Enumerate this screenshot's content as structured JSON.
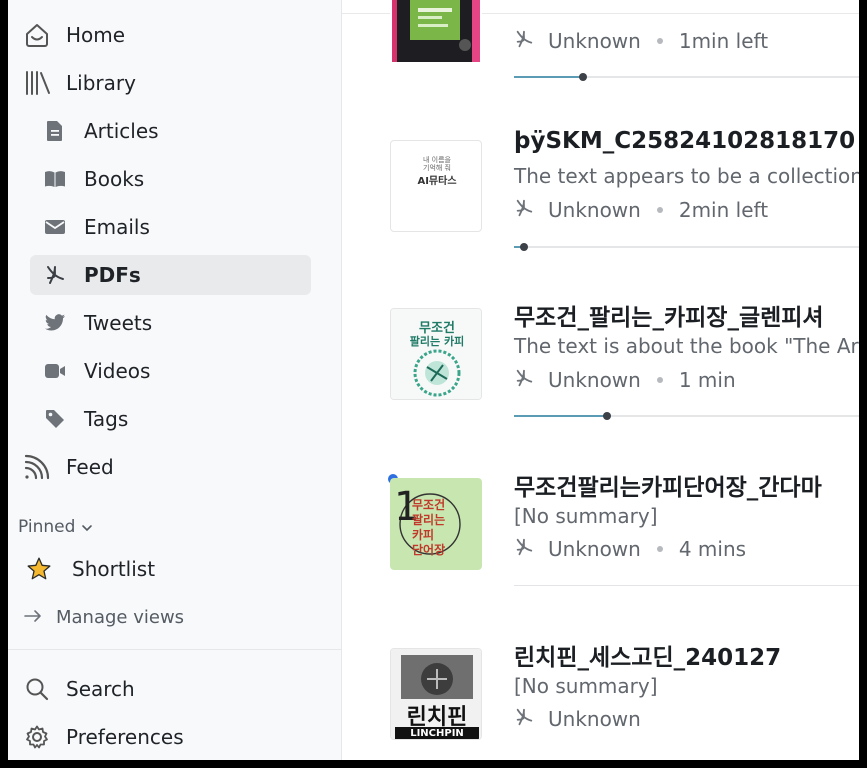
{
  "sidebar": {
    "home": "Home",
    "library": "Library",
    "articles": "Articles",
    "books": "Books",
    "emails": "Emails",
    "pdfs": "PDFs",
    "tweets": "Tweets",
    "videos": "Videos",
    "tags": "Tags",
    "feed": "Feed",
    "pinned": "Pinned",
    "shortlist": "Shortlist",
    "manage_views": "Manage views",
    "search": "Search",
    "preferences": "Preferences"
  },
  "documents": [
    {
      "title": "",
      "summary": "",
      "author": "Unknown",
      "time": "1min left",
      "progress": 0.2
    },
    {
      "title": "þÿSKM_C25824102818170",
      "summary": "The text appears to be a collection",
      "author": "Unknown",
      "time": "2min left",
      "progress": 0.03,
      "cover": {
        "line1": "내 이름을",
        "line2": "기억해 줘",
        "word": "AI뮤타스"
      }
    },
    {
      "title": "무조건_팔리는_카피장_글렌피셔",
      "summary": "The text is about the book \"The Art",
      "author": "Unknown",
      "time": "1 min",
      "progress": 0.27,
      "cover": {
        "line1": "무조건",
        "line2": "팔리는 카피"
      }
    },
    {
      "title": "무조건팔리는카피단어장_간다마",
      "summary": "[No summary]",
      "author": "Unknown",
      "time": "4 mins",
      "unread": true,
      "cover": {
        "line1": "무조건",
        "line2": "팔리는",
        "line3": "카피",
        "line4": "단어장",
        "number": "1"
      }
    },
    {
      "title": "린치핀_세스고딘_240127",
      "summary": "[No summary]",
      "author": "Unknown",
      "cover": {
        "word": "린치핀",
        "sub": "LINCHPIN"
      }
    }
  ],
  "colors": {
    "accent": "#2f6fe0",
    "progress": "#5b9bb3",
    "active_bg": "#e9eaec",
    "star": "#f5b82e"
  }
}
